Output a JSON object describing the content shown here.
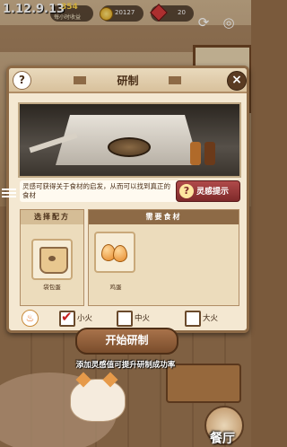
{
  "hud": {
    "version": "1.12.9.13",
    "gold_rate": "354",
    "gold_rate_caption": "每小时收益",
    "coins": "20127",
    "gems": "20"
  },
  "dialog": {
    "title": "研制",
    "hint_text": "灵感可获得关于食材的启发，从而可以找到真正的食材",
    "hint_button": "灵感提示",
    "recipe_header": "选择配方",
    "recipe_item": "袋包蛋",
    "ingredients_header": "需要食材",
    "ingredient_item": "鸡蛋",
    "heat": {
      "small": "小火",
      "medium": "中火",
      "large": "大火",
      "selected": "small"
    },
    "start_button": "开始研制",
    "tip": "添加灵感值可提升研制成功率"
  },
  "nav": {
    "restaurant": "餐厅"
  },
  "colors": {
    "panel": "#f4e8d2",
    "frame": "#8d6a46",
    "hint_button": "#9a3a3a",
    "start_button": "#8f5f3b"
  }
}
